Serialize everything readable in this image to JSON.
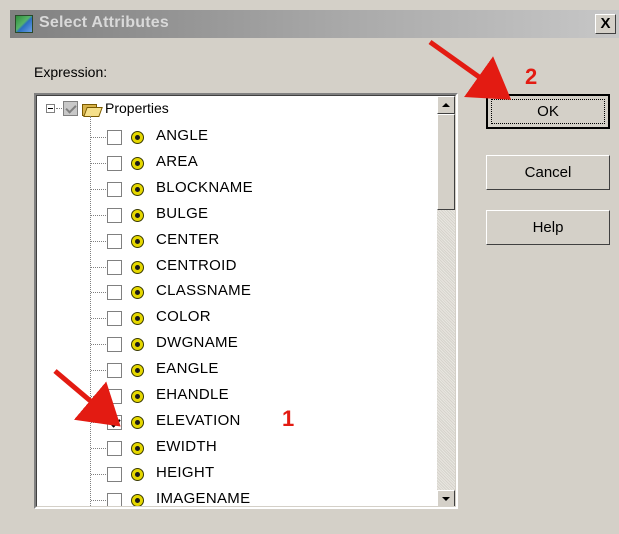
{
  "dialog": {
    "title": "Select Attributes",
    "close_label": "X",
    "expression_label": "Expression:",
    "buttons": {
      "ok": "OK",
      "cancel": "Cancel",
      "help": "Help"
    }
  },
  "tree": {
    "root": {
      "label": "Properties",
      "checked": true,
      "dimmed": true,
      "expanded": true
    },
    "items": [
      {
        "label": "ANGLE",
        "checked": false
      },
      {
        "label": "AREA",
        "checked": false
      },
      {
        "label": "BLOCKNAME",
        "checked": false
      },
      {
        "label": "BULGE",
        "checked": false
      },
      {
        "label": "CENTER",
        "checked": false
      },
      {
        "label": "CENTROID",
        "checked": false
      },
      {
        "label": "CLASSNAME",
        "checked": false
      },
      {
        "label": "COLOR",
        "checked": false
      },
      {
        "label": "DWGNAME",
        "checked": false
      },
      {
        "label": "EANGLE",
        "checked": false
      },
      {
        "label": "EHANDLE",
        "checked": false
      },
      {
        "label": "ELEVATION",
        "checked": true
      },
      {
        "label": "EWIDTH",
        "checked": false
      },
      {
        "label": "HEIGHT",
        "checked": false
      },
      {
        "label": "IMAGENAME",
        "checked": false
      }
    ]
  },
  "annotations": {
    "step1": "1",
    "step2": "2",
    "arrow_color": "#e31b12"
  },
  "colors": {
    "dialog_bg": "#d4d0c8",
    "titlebar_text": "#d9d9d9",
    "list_bg": "#ffffff"
  }
}
